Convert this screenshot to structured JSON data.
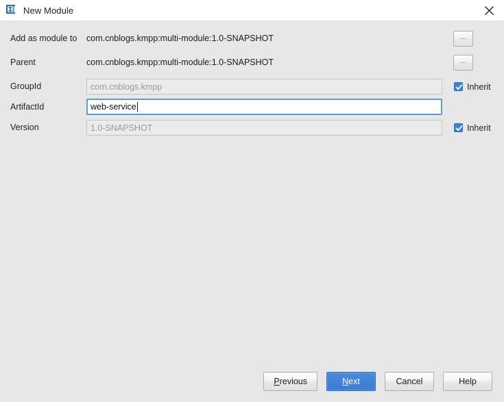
{
  "window": {
    "title": "New Module",
    "icon": "intellij-idea-icon",
    "close_label": "✕",
    "titlebar_bg": "#ffffff",
    "body_bg": "#e7e7e7"
  },
  "form": {
    "rows": [
      {
        "label": "Add as module to",
        "type": "static",
        "value": "com.cnblogs.kmpp:multi-module:1.0-SNAPSHOT",
        "browse_label": "...",
        "has_browse": true,
        "has_inherit": false
      },
      {
        "label": "Parent",
        "type": "static",
        "value": "com.cnblogs.kmpp:multi-module:1.0-SNAPSHOT",
        "browse_label": "...",
        "has_browse": true,
        "has_inherit": false
      },
      {
        "label": "GroupId",
        "type": "field",
        "state": "disabled",
        "value": "com.cnblogs.kmpp",
        "has_browse": false,
        "has_inherit": true,
        "inherit_label": "Inherit",
        "inherit_checked": true
      },
      {
        "label": "ArtifactId",
        "type": "field",
        "state": "focused",
        "value": "web-service",
        "has_browse": false,
        "has_inherit": false
      },
      {
        "label": "Version",
        "type": "field",
        "state": "disabled",
        "value": "1.0-SNAPSHOT",
        "has_browse": false,
        "has_inherit": true,
        "inherit_label": "Inherit",
        "inherit_checked": true
      }
    ]
  },
  "footer": {
    "previous_label": "Previous",
    "previous_mnemonic": "P",
    "next_label": "Next",
    "next_mnemonic": "N",
    "cancel_label": "Cancel",
    "help_label": "Help"
  },
  "colors": {
    "accent": "#3c7fd6",
    "checkbox": "#3c83d4",
    "focus_border": "#5b9bd5",
    "disabled_text": "#9a9a9a"
  }
}
